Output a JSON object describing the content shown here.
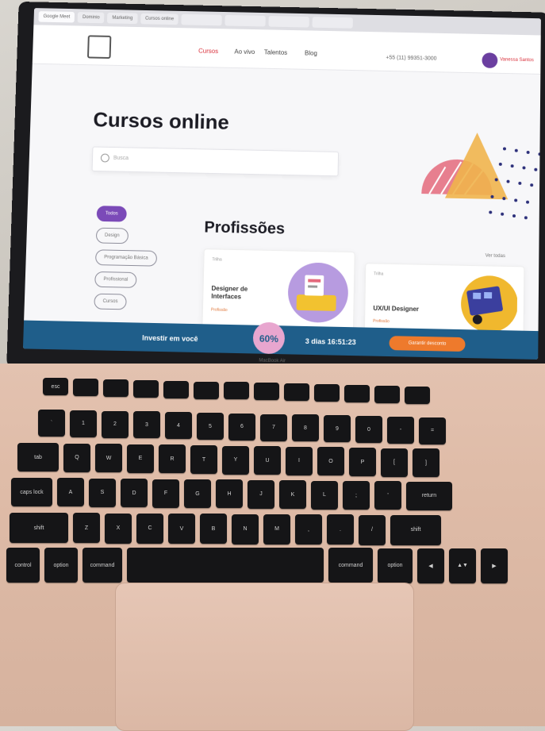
{
  "browser": {
    "tabs": [
      "Google Meet",
      "Dominio",
      "Marketing",
      "Cursos online",
      "",
      "",
      "",
      "",
      "",
      ""
    ]
  },
  "site": {
    "logo_text": "",
    "nav": [
      "Cursos",
      "Ao vivo",
      "Talentos",
      "Blog"
    ],
    "phone": "+55 (11) 99351-3000",
    "user": "Vanessa Santos"
  },
  "page": {
    "title": "Cursos online",
    "search_placeholder": "Busca",
    "filters": [
      "Todos",
      "Design",
      "Programação Básica",
      "Profissional",
      "Cursos"
    ],
    "section_title": "Profissões",
    "see_all": "Ver todas"
  },
  "cards": [
    {
      "tag": "Trilha",
      "title": "Designer de Interfaces",
      "sub": "Profissão"
    },
    {
      "tag": "Trilha",
      "title": "UX/UI Designer",
      "sub": "Profissão"
    }
  ],
  "promo": {
    "left_text": "Investir em você",
    "badge": "60%",
    "countdown": "3 dias 16:51:23",
    "cta": "Garantir desconto"
  },
  "laptop": {
    "brand": "MacBook Air"
  },
  "keyboard": {
    "row1": [
      "esc",
      "",
      "",
      "",
      "",
      "",
      "",
      "",
      "",
      "",
      "",
      "",
      ""
    ],
    "row2": [
      "`",
      "1",
      "2",
      "3",
      "4",
      "5",
      "6",
      "7",
      "8",
      "9",
      "0",
      "-",
      "="
    ],
    "row3": [
      "tab",
      "Q",
      "W",
      "E",
      "R",
      "T",
      "Y",
      "U",
      "I",
      "O",
      "P",
      "[",
      "]"
    ],
    "row4": [
      "caps lock",
      "A",
      "S",
      "D",
      "F",
      "G",
      "H",
      "J",
      "K",
      "L",
      ";",
      "'",
      "return"
    ],
    "row5": [
      "shift",
      "Z",
      "X",
      "C",
      "V",
      "B",
      "N",
      "M",
      ",",
      ".",
      "/",
      "shift"
    ],
    "row6": [
      "control",
      "option",
      "command",
      "",
      "command",
      "option",
      "◀",
      "▲▼",
      "▶"
    ]
  },
  "colors": {
    "accent": "#7b4ab8",
    "promo_bg": "#1f5e8a",
    "cta": "#ee7a2c",
    "nav_active": "#d9303b"
  }
}
